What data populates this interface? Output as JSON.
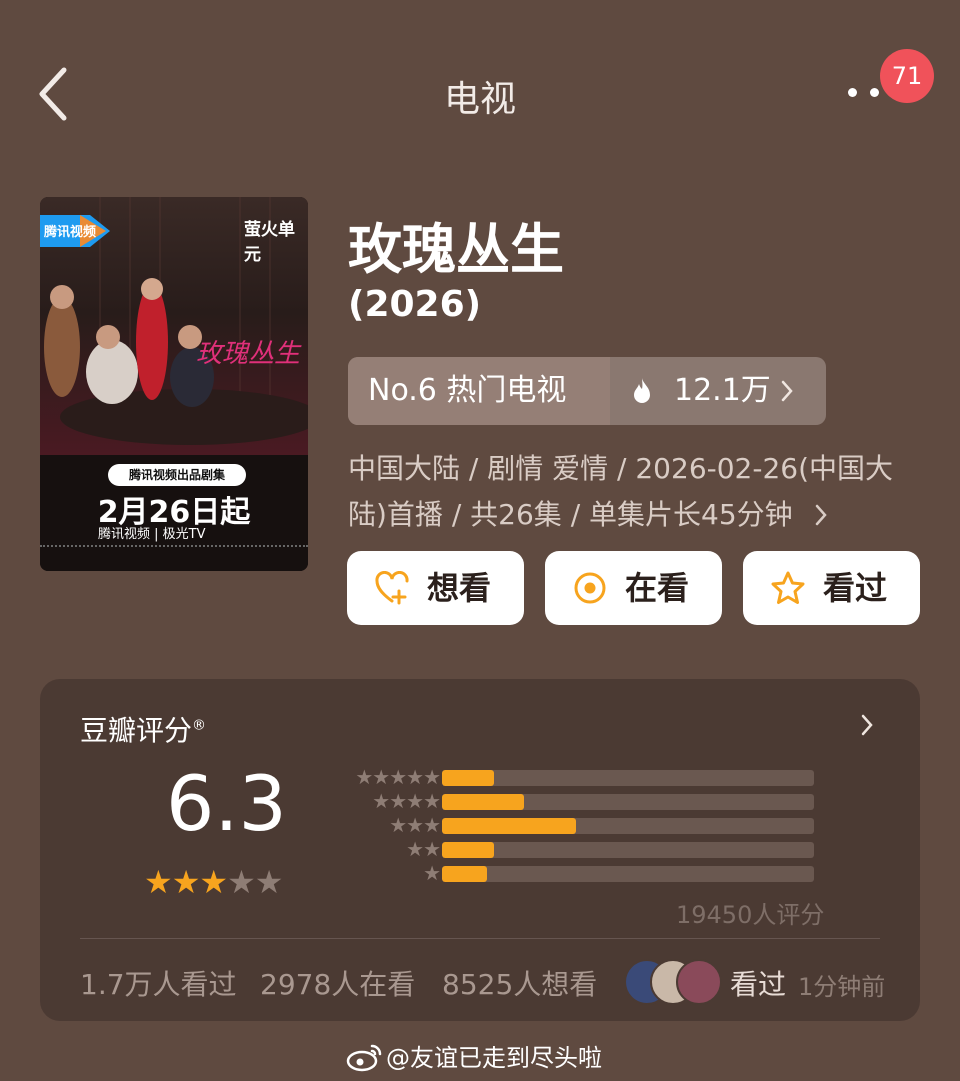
{
  "nav": {
    "title": "电视",
    "badge_count": "71"
  },
  "poster": {
    "platform_logo": "腾讯视频",
    "brand": "萤火单元",
    "cursive_title": "玫瑰丛生",
    "pill": "腾讯视频出品剧集",
    "date": "2月26日起",
    "platforms": "腾讯视频 | 极光TV"
  },
  "header": {
    "title": "玫瑰丛生",
    "year": "(2026)",
    "rank": "No.6 热门电视",
    "heat": "12.1万"
  },
  "meta": {
    "line1": "中国大陆 / 剧情 爱情 / 2026-02-26(中国大",
    "line2": "陆)首播 / 共26集 / 单集片长45分钟"
  },
  "actions": [
    {
      "label": "想看",
      "icon": "heart-plus-icon"
    },
    {
      "label": "在看",
      "icon": "circle-dot-icon"
    },
    {
      "label": "看过",
      "icon": "star-outline-icon"
    }
  ],
  "rating": {
    "title": "豆瓣评分",
    "trademark": "®",
    "score": "6.3",
    "stars_filled": 3,
    "stars_total": 5,
    "distribution": [
      {
        "stars": 5,
        "fraction": 0.14
      },
      {
        "stars": 4,
        "fraction": 0.22
      },
      {
        "stars": 3,
        "fraction": 0.36
      },
      {
        "stars": 2,
        "fraction": 0.14
      },
      {
        "stars": 1,
        "fraction": 0.12
      }
    ],
    "count_text": "19450人评分",
    "stats": {
      "watched": "1.7万人看过",
      "watching": "2978人在看",
      "want": "8525人想看"
    },
    "friend_status": "看过",
    "friend_time": "1分钟前"
  },
  "colors": {
    "bg": "#5f4a40",
    "card": "#4b3a33",
    "accent": "#f7a41e",
    "badge": "#f0525a"
  },
  "watermark": "@友谊已走到尽头啦"
}
